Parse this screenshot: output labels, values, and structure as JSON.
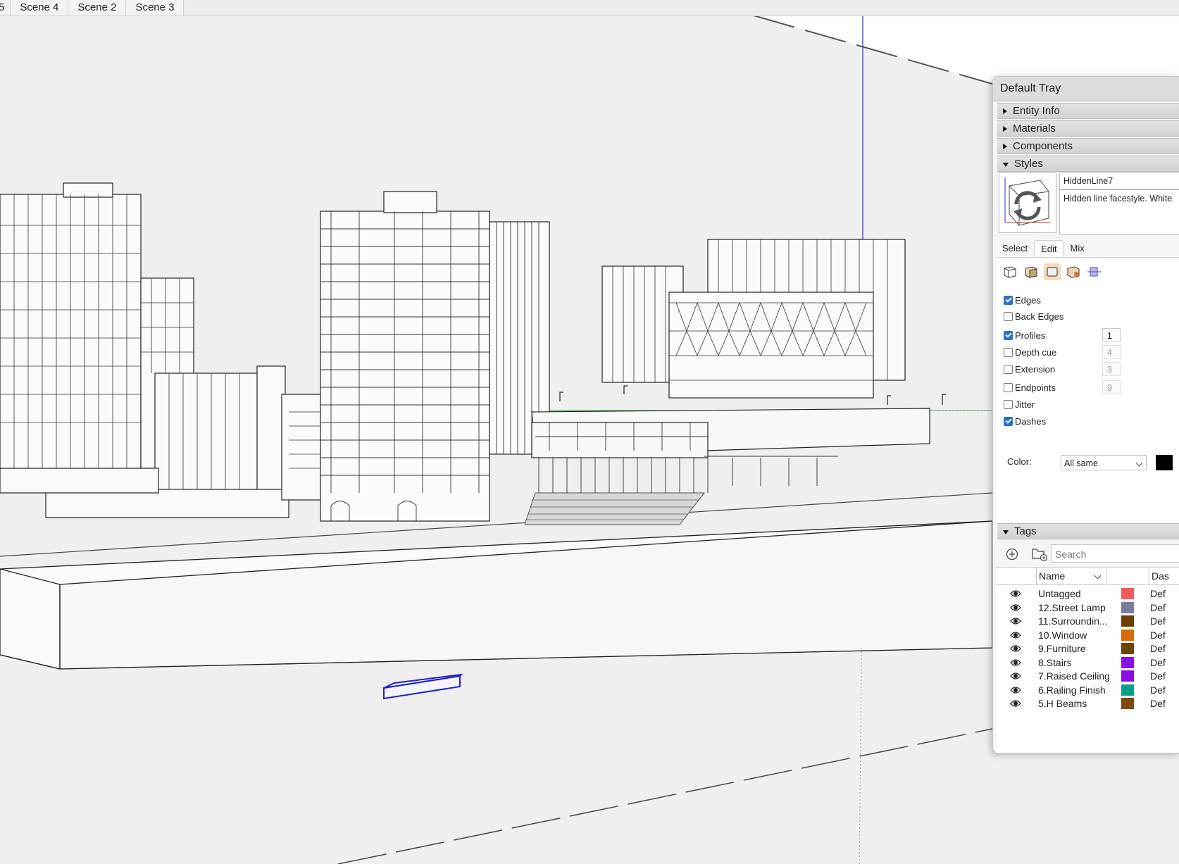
{
  "scene_tabs": [
    {
      "label": "5",
      "partial": true
    },
    {
      "label": "Scene 4"
    },
    {
      "label": "Scene 2"
    },
    {
      "label": "Scene 3"
    }
  ],
  "tray": {
    "title": "Default Tray",
    "panels": [
      {
        "label": "Entity Info",
        "expanded": false
      },
      {
        "label": "Materials",
        "expanded": false
      },
      {
        "label": "Components",
        "expanded": false
      },
      {
        "label": "Styles",
        "expanded": true
      }
    ],
    "style": {
      "name": "HiddenLine7",
      "description": "Hidden line facestyle. White"
    },
    "style_tabs": [
      "Select",
      "Edit",
      "Mix"
    ],
    "active_style_tab": "Edit",
    "edge_settings": {
      "edges": {
        "label": "Edges",
        "checked": true
      },
      "back_edges": {
        "label": "Back Edges",
        "checked": false
      },
      "profiles": {
        "label": "Profiles",
        "checked": true,
        "value": "1"
      },
      "depth_cue": {
        "label": "Depth cue",
        "checked": false,
        "value": "4"
      },
      "extension": {
        "label": "Extension",
        "checked": false,
        "value": "3"
      },
      "endpoints": {
        "label": "Endpoints",
        "checked": false,
        "value": "9"
      },
      "jitter": {
        "label": "Jitter",
        "checked": false
      },
      "dashes": {
        "label": "Dashes",
        "checked": true
      },
      "color_label": "Color:",
      "color_value": "All same",
      "color_swatch": "#000000"
    },
    "tags": {
      "header": "Tags",
      "search_placeholder": "Search",
      "columns": {
        "name": "Name",
        "dashes": "Das"
      },
      "rows": [
        {
          "name": "Untagged",
          "color": "#f05a5a",
          "dash": "Def"
        },
        {
          "name": "12.Street Lamp",
          "color": "#7b7b9c",
          "dash": "Def"
        },
        {
          "name": "11.Surroundin...",
          "color": "#6b3f00",
          "dash": "Def"
        },
        {
          "name": "10.Window",
          "color": "#d86a0a",
          "dash": "Def"
        },
        {
          "name": "9.Furniture",
          "color": "#6b4504",
          "dash": "Def"
        },
        {
          "name": "8.Stairs",
          "color": "#8a10e0",
          "dash": "Def"
        },
        {
          "name": "7.Raised Ceiling",
          "color": "#8a10e0",
          "dash": "Def"
        },
        {
          "name": "6.Railing Finish",
          "color": "#0e9e87",
          "dash": "Def"
        },
        {
          "name": "5.H Beams",
          "color": "#7a4a10",
          "dash": "Def"
        }
      ]
    }
  }
}
